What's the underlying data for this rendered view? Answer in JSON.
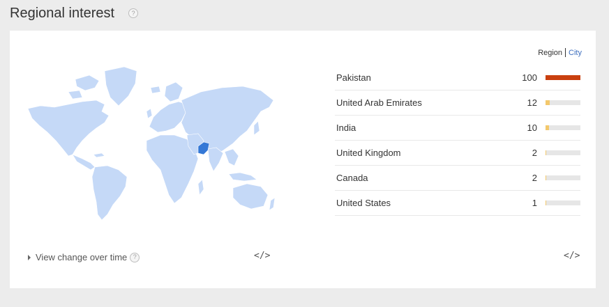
{
  "header": {
    "title": "Regional interest",
    "help": "?"
  },
  "toggle": {
    "region": "Region",
    "city": "City"
  },
  "regions": [
    {
      "name": "Pakistan",
      "value": 100
    },
    {
      "name": "United Arab Emirates",
      "value": 12
    },
    {
      "name": "India",
      "value": 10
    },
    {
      "name": "United Kingdom",
      "value": 2
    },
    {
      "name": "Canada",
      "value": 2
    },
    {
      "name": "United States",
      "value": 1
    }
  ],
  "footer": {
    "view_change": "View change over time",
    "help": "?",
    "embed": "</>"
  },
  "colors": {
    "map_land": "#c5d9f7",
    "map_highlight": "#3478d6",
    "bar_top": "#c9400f",
    "bar_low": "#f3c86c",
    "bar_track": "#e6e6e6",
    "link": "#3d6ebe"
  }
}
